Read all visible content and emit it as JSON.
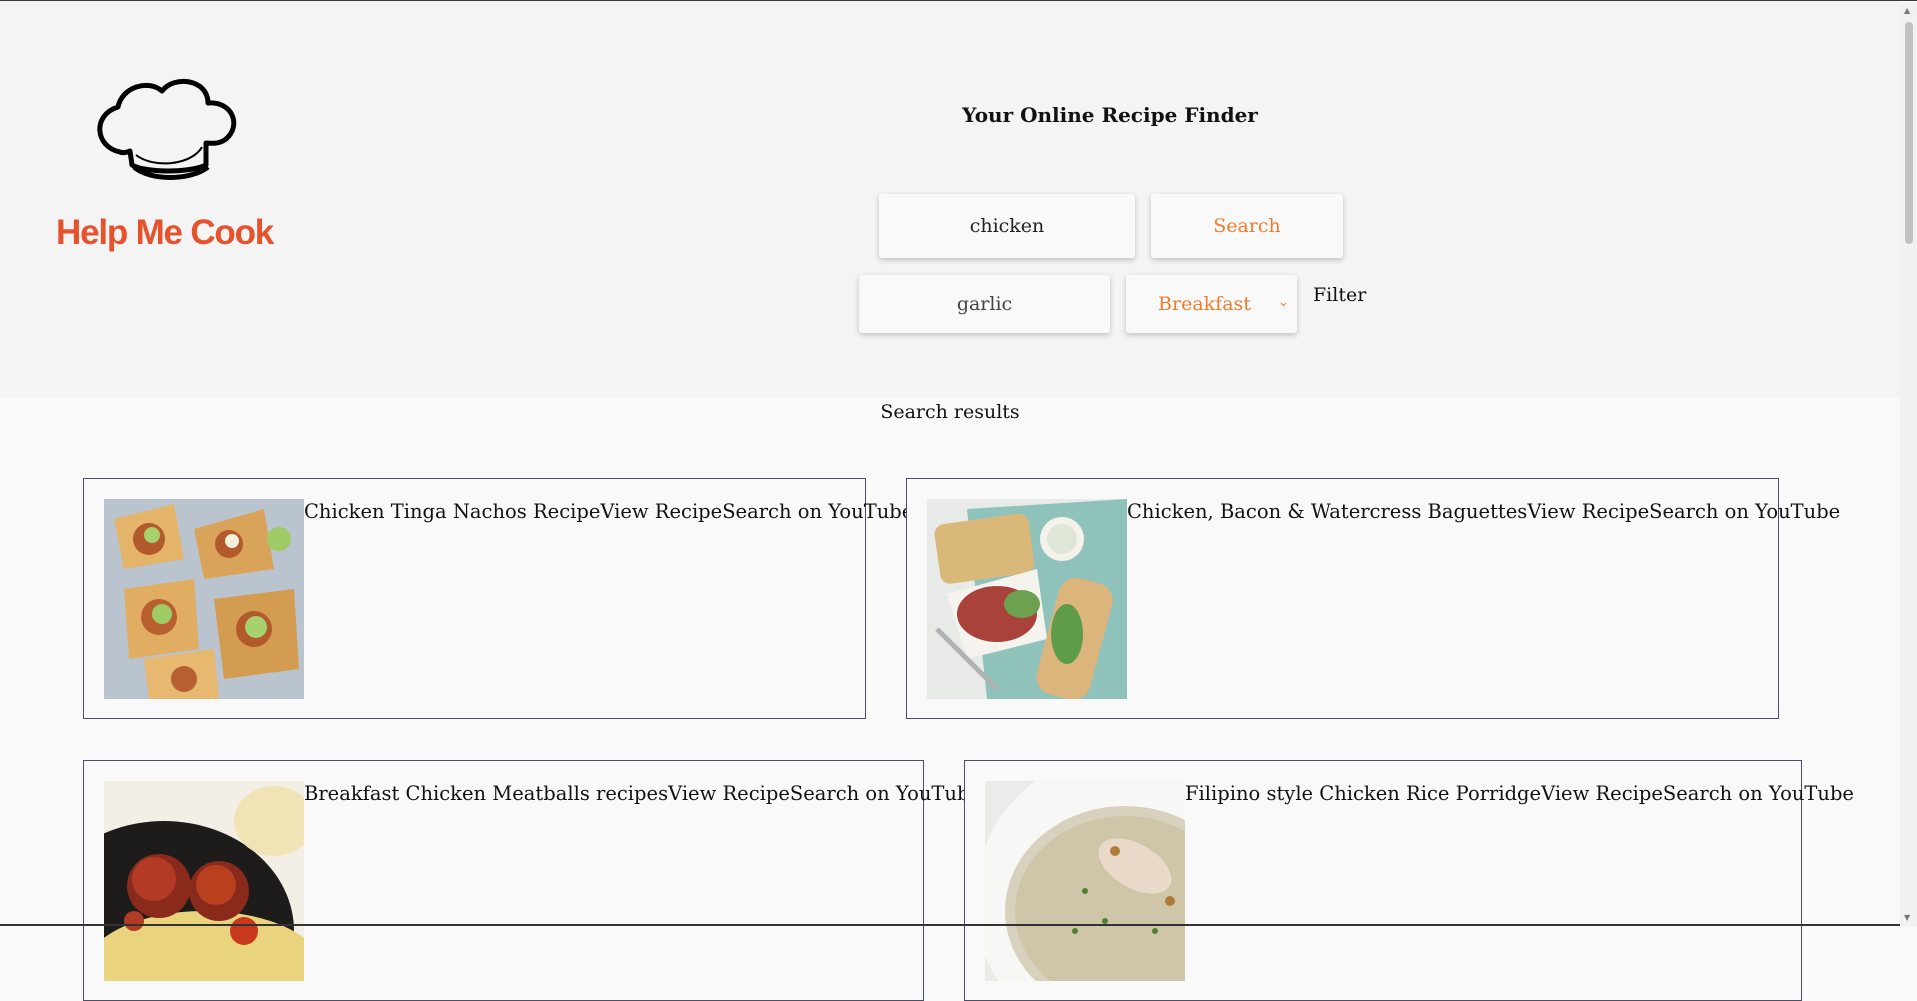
{
  "brand": {
    "name": "Help Me Cook",
    "tagline": "Your Online Recipe Finder",
    "accent": "#e6522c"
  },
  "search": {
    "query": "chicken",
    "button_label": "Search",
    "ingredient": "garlic",
    "meal_type": "Breakfast",
    "filter_label": "Filter"
  },
  "results": {
    "title": "Search results",
    "cards": [
      {
        "name": "Chicken Tinga Nachos Recipe",
        "view_label": "View Recipe",
        "youtube_label": "Search on YouTube"
      },
      {
        "name": "Chicken, Bacon & Watercress Baguettes",
        "view_label": "View Recipe",
        "youtube_label": "Search on YouTube"
      },
      {
        "name": "Breakfast Chicken Meatballs recipes",
        "view_label": "View Recipe",
        "youtube_label": "Search on YouTube"
      },
      {
        "name": "Filipino style Chicken Rice Porridge",
        "view_label": "View Recipe",
        "youtube_label": "Search on YouTube"
      }
    ]
  },
  "colors": {
    "accent_orange": "#f07b2a",
    "card_border": "#4a4e6a",
    "header_bg": "#f4f4f5"
  }
}
